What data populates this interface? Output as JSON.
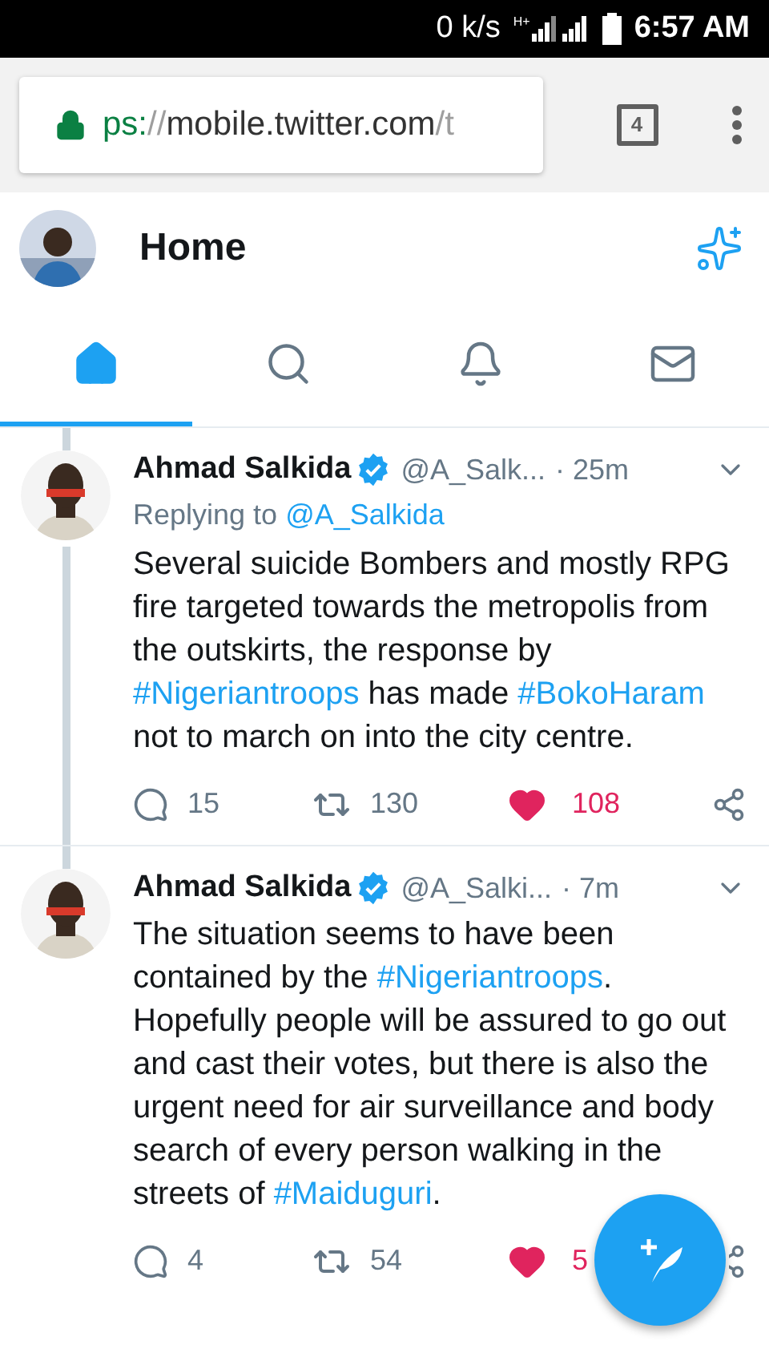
{
  "status_bar": {
    "speed": "0 k/s",
    "network": "H+",
    "time": "6:57 AM"
  },
  "browser": {
    "url_scheme": "ps:",
    "url_sep": "//",
    "url_host": "mobile.twitter.com",
    "url_rest": "/t",
    "tab_count": "4"
  },
  "header": {
    "title": "Home"
  },
  "tabs": [
    {
      "kind": "home",
      "selected": true
    },
    {
      "kind": "search",
      "selected": false
    },
    {
      "kind": "notifications",
      "selected": false
    },
    {
      "kind": "messages",
      "selected": false
    }
  ],
  "tweets": [
    {
      "name": "Ahmad Salkida",
      "verified": true,
      "handle": "@A_Salk...",
      "time": "· 25m",
      "thread_above": true,
      "thread_below": true,
      "reply_label": "Replying to",
      "reply_to": "@A_Salkida",
      "body": [
        {
          "kind": "text",
          "text": "Several suicide Bombers and mostly RPG fire targeted towards the metropolis from the outskirts, the response by "
        },
        {
          "kind": "hashtag",
          "text": "#Nigeriantroops"
        },
        {
          "kind": "text",
          "text": " has made "
        },
        {
          "kind": "hashtag",
          "text": "#BokoHaram"
        },
        {
          "kind": "text",
          "text": " not to march on into the city centre."
        }
      ],
      "replies": "15",
      "retweets": "130",
      "likes": "108",
      "liked": true
    },
    {
      "name": "Ahmad Salkida",
      "verified": true,
      "handle": "@A_Salki...",
      "time": "· 7m",
      "thread_above": true,
      "thread_below": false,
      "body": [
        {
          "kind": "text",
          "text": "The situation seems to have been contained by the "
        },
        {
          "kind": "hashtag",
          "text": "#Nigeriantroops"
        },
        {
          "kind": "text",
          "text": ". Hopefully people will be assured to go out and cast their votes, but there is also the urgent need for air surveillance and body search of every person walking in the streets of "
        },
        {
          "kind": "hashtag",
          "text": "#Maiduguri"
        },
        {
          "kind": "text",
          "text": "."
        }
      ],
      "replies": "4",
      "retweets": "54",
      "likes": "5",
      "liked": true
    }
  ]
}
